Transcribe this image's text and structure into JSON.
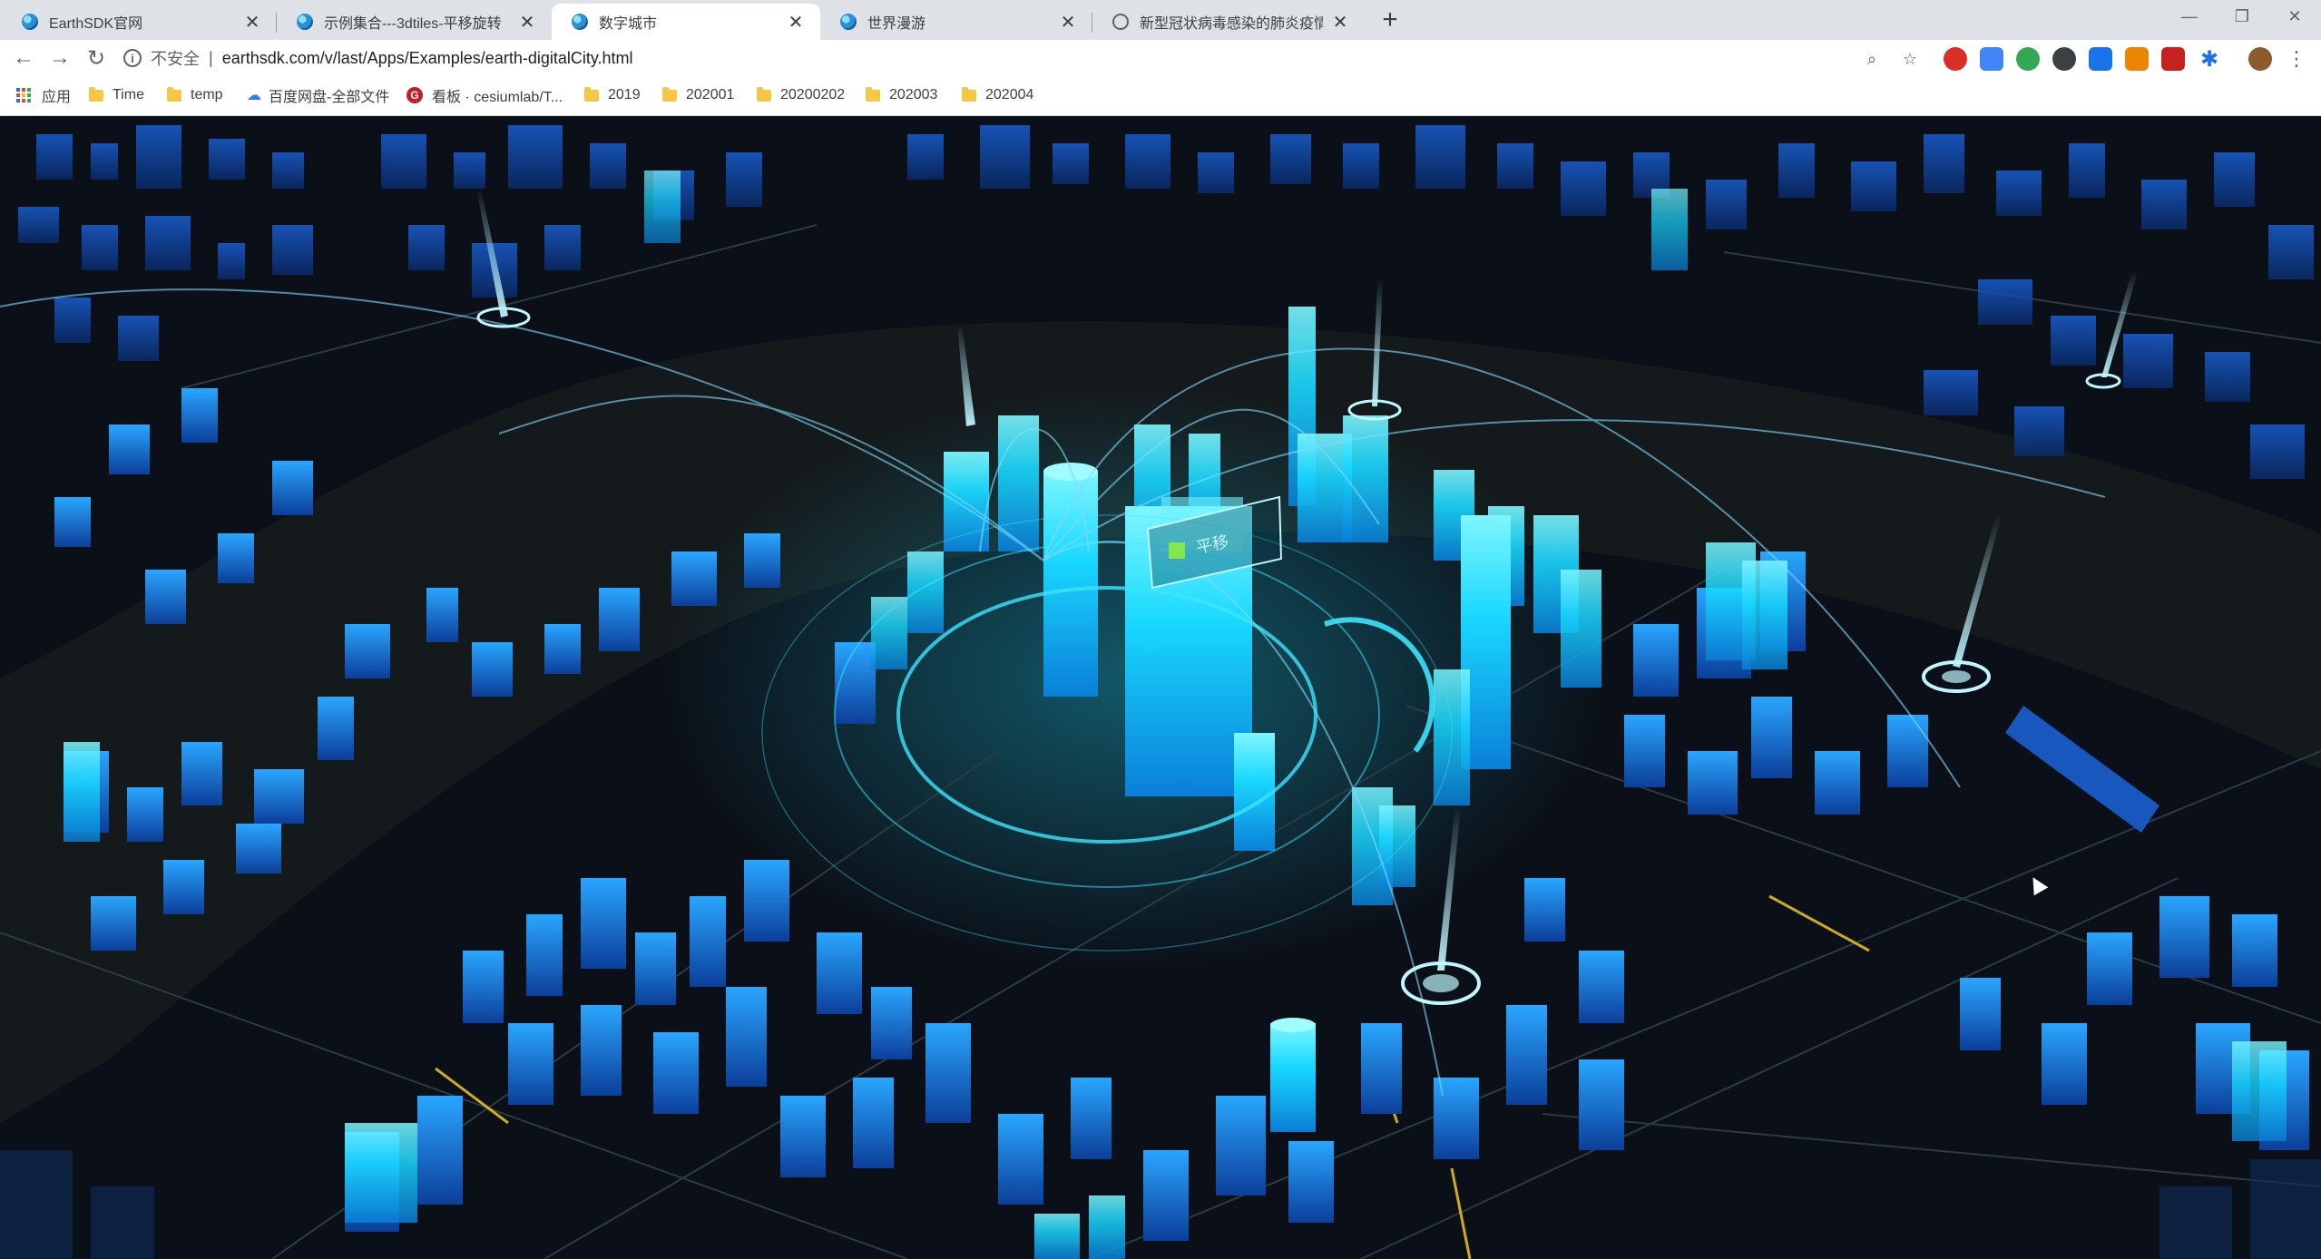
{
  "tabs": [
    {
      "title": "EarthSDK官网",
      "active": false,
      "icon": "earthsdk-favicon-icon"
    },
    {
      "title": "示例集合---3dtiles-平移旋转",
      "active": false,
      "icon": "earthsdk-favicon-icon"
    },
    {
      "title": "数字城市",
      "active": true,
      "icon": "earthsdk-favicon-icon"
    },
    {
      "title": "世界漫游",
      "active": false,
      "icon": "earthsdk-favicon-icon"
    },
    {
      "title": "新型冠状病毒感染的肺炎疫情分",
      "active": false,
      "icon": "globe-icon"
    }
  ],
  "toolbar": {
    "security_label": "不安全",
    "url": "earthsdk.com/v/last/Apps/Examples/earth-digitalCity.html"
  },
  "bookmarks": [
    {
      "label": "应用",
      "icon": "apps-grid-icon"
    },
    {
      "label": "Time",
      "icon": "folder-icon"
    },
    {
      "label": "temp",
      "icon": "folder-icon"
    },
    {
      "label": "百度网盘-全部文件",
      "icon": "baidu-netdisk-icon"
    },
    {
      "label": "看板 · cesiumlab/T...",
      "icon": "gitee-icon"
    },
    {
      "label": "2019",
      "icon": "folder-icon"
    },
    {
      "label": "202001",
      "icon": "folder-icon"
    },
    {
      "label": "20200202",
      "icon": "folder-icon"
    },
    {
      "label": "202003",
      "icon": "folder-icon"
    },
    {
      "label": "202004",
      "icon": "folder-icon"
    }
  ],
  "scene": {
    "billboard_text": "平移",
    "colors": {
      "building_glow": "#19d8ff",
      "building_dark": "#0d4fb5",
      "building_bright": "#1f8bff",
      "river": "#141a1c",
      "ground": "#0b1018",
      "road_highlight": "#ffd21f"
    }
  }
}
